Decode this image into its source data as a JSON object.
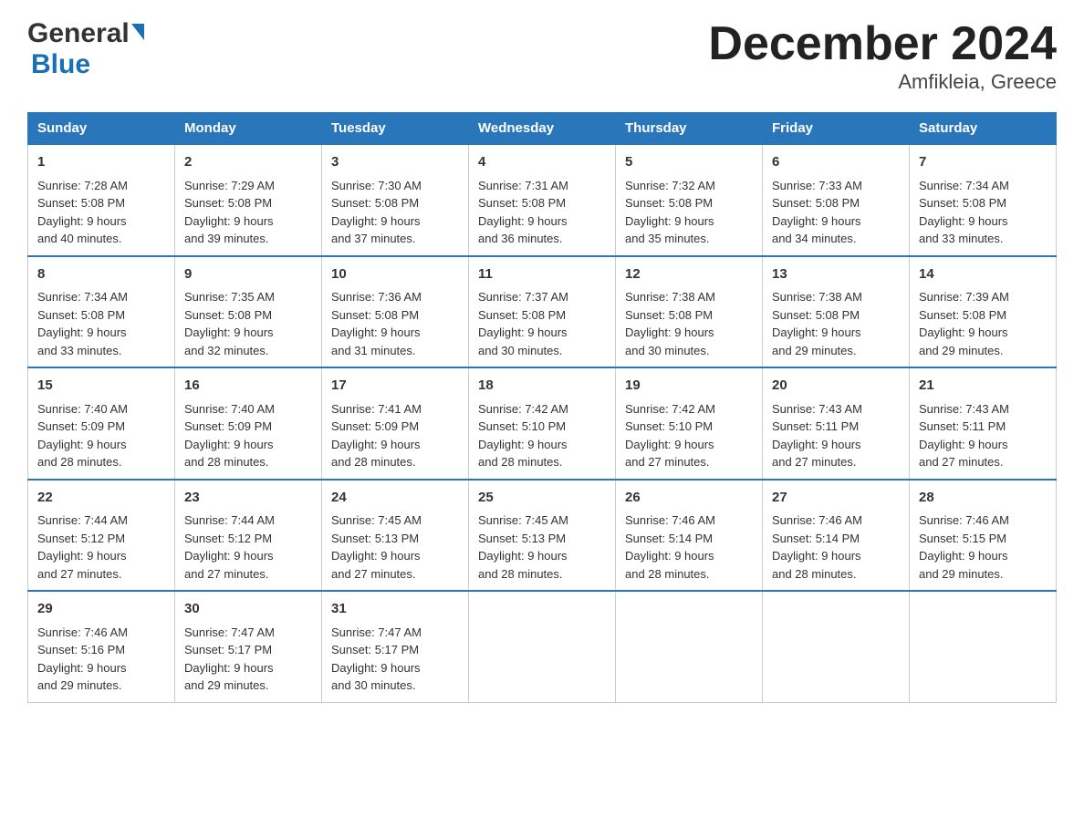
{
  "logo": {
    "general": "General",
    "blue": "Blue",
    "triangle": true
  },
  "title": "December 2024",
  "subtitle": "Amfikleia, Greece",
  "calendar": {
    "days_of_week": [
      "Sunday",
      "Monday",
      "Tuesday",
      "Wednesday",
      "Thursday",
      "Friday",
      "Saturday"
    ],
    "weeks": [
      [
        {
          "day": "1",
          "sunrise": "7:28 AM",
          "sunset": "5:08 PM",
          "daylight": "9 hours and 40 minutes."
        },
        {
          "day": "2",
          "sunrise": "7:29 AM",
          "sunset": "5:08 PM",
          "daylight": "9 hours and 39 minutes."
        },
        {
          "day": "3",
          "sunrise": "7:30 AM",
          "sunset": "5:08 PM",
          "daylight": "9 hours and 37 minutes."
        },
        {
          "day": "4",
          "sunrise": "7:31 AM",
          "sunset": "5:08 PM",
          "daylight": "9 hours and 36 minutes."
        },
        {
          "day": "5",
          "sunrise": "7:32 AM",
          "sunset": "5:08 PM",
          "daylight": "9 hours and 35 minutes."
        },
        {
          "day": "6",
          "sunrise": "7:33 AM",
          "sunset": "5:08 PM",
          "daylight": "9 hours and 34 minutes."
        },
        {
          "day": "7",
          "sunrise": "7:34 AM",
          "sunset": "5:08 PM",
          "daylight": "9 hours and 33 minutes."
        }
      ],
      [
        {
          "day": "8",
          "sunrise": "7:34 AM",
          "sunset": "5:08 PM",
          "daylight": "9 hours and 33 minutes."
        },
        {
          "day": "9",
          "sunrise": "7:35 AM",
          "sunset": "5:08 PM",
          "daylight": "9 hours and 32 minutes."
        },
        {
          "day": "10",
          "sunrise": "7:36 AM",
          "sunset": "5:08 PM",
          "daylight": "9 hours and 31 minutes."
        },
        {
          "day": "11",
          "sunrise": "7:37 AM",
          "sunset": "5:08 PM",
          "daylight": "9 hours and 30 minutes."
        },
        {
          "day": "12",
          "sunrise": "7:38 AM",
          "sunset": "5:08 PM",
          "daylight": "9 hours and 30 minutes."
        },
        {
          "day": "13",
          "sunrise": "7:38 AM",
          "sunset": "5:08 PM",
          "daylight": "9 hours and 29 minutes."
        },
        {
          "day": "14",
          "sunrise": "7:39 AM",
          "sunset": "5:08 PM",
          "daylight": "9 hours and 29 minutes."
        }
      ],
      [
        {
          "day": "15",
          "sunrise": "7:40 AM",
          "sunset": "5:09 PM",
          "daylight": "9 hours and 28 minutes."
        },
        {
          "day": "16",
          "sunrise": "7:40 AM",
          "sunset": "5:09 PM",
          "daylight": "9 hours and 28 minutes."
        },
        {
          "day": "17",
          "sunrise": "7:41 AM",
          "sunset": "5:09 PM",
          "daylight": "9 hours and 28 minutes."
        },
        {
          "day": "18",
          "sunrise": "7:42 AM",
          "sunset": "5:10 PM",
          "daylight": "9 hours and 28 minutes."
        },
        {
          "day": "19",
          "sunrise": "7:42 AM",
          "sunset": "5:10 PM",
          "daylight": "9 hours and 27 minutes."
        },
        {
          "day": "20",
          "sunrise": "7:43 AM",
          "sunset": "5:11 PM",
          "daylight": "9 hours and 27 minutes."
        },
        {
          "day": "21",
          "sunrise": "7:43 AM",
          "sunset": "5:11 PM",
          "daylight": "9 hours and 27 minutes."
        }
      ],
      [
        {
          "day": "22",
          "sunrise": "7:44 AM",
          "sunset": "5:12 PM",
          "daylight": "9 hours and 27 minutes."
        },
        {
          "day": "23",
          "sunrise": "7:44 AM",
          "sunset": "5:12 PM",
          "daylight": "9 hours and 27 minutes."
        },
        {
          "day": "24",
          "sunrise": "7:45 AM",
          "sunset": "5:13 PM",
          "daylight": "9 hours and 27 minutes."
        },
        {
          "day": "25",
          "sunrise": "7:45 AM",
          "sunset": "5:13 PM",
          "daylight": "9 hours and 28 minutes."
        },
        {
          "day": "26",
          "sunrise": "7:46 AM",
          "sunset": "5:14 PM",
          "daylight": "9 hours and 28 minutes."
        },
        {
          "day": "27",
          "sunrise": "7:46 AM",
          "sunset": "5:14 PM",
          "daylight": "9 hours and 28 minutes."
        },
        {
          "day": "28",
          "sunrise": "7:46 AM",
          "sunset": "5:15 PM",
          "daylight": "9 hours and 29 minutes."
        }
      ],
      [
        {
          "day": "29",
          "sunrise": "7:46 AM",
          "sunset": "5:16 PM",
          "daylight": "9 hours and 29 minutes."
        },
        {
          "day": "30",
          "sunrise": "7:47 AM",
          "sunset": "5:17 PM",
          "daylight": "9 hours and 29 minutes."
        },
        {
          "day": "31",
          "sunrise": "7:47 AM",
          "sunset": "5:17 PM",
          "daylight": "9 hours and 30 minutes."
        },
        null,
        null,
        null,
        null
      ]
    ],
    "labels": {
      "sunrise": "Sunrise:",
      "sunset": "Sunset:",
      "daylight": "Daylight:"
    }
  }
}
